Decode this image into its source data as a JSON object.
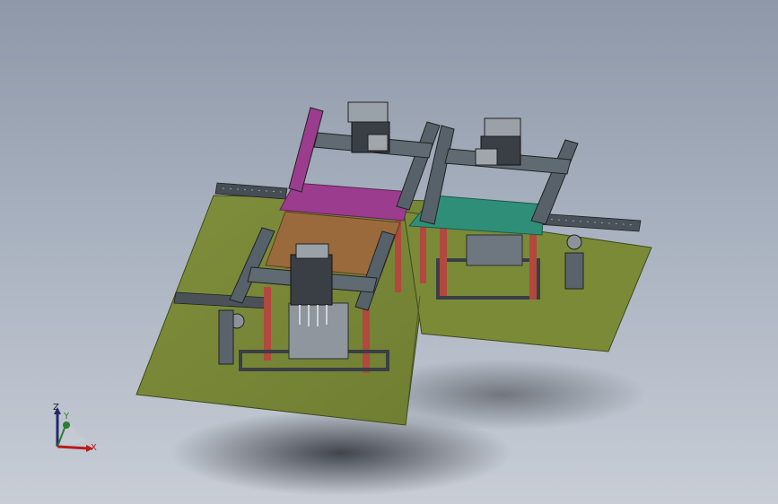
{
  "triad": {
    "z_label": "Z",
    "y_label": "Y",
    "x_label": "X"
  },
  "colors": {
    "background_top": "#8e98a8",
    "background_bottom": "#c8cdd6",
    "base_plate": "#7c8a3a",
    "magenta_frame": "#9c3c8e",
    "teal_frame": "#2f8e78",
    "orange_plate": "#9a6a3c",
    "post_red": "#b2483e",
    "steel_gray": "#5a636b",
    "axis_z": "#1e2a6e",
    "axis_y": "#2e7d32",
    "axis_x": "#b71c1c"
  },
  "icons": {
    "triad": "coordinate-triad-icon"
  }
}
